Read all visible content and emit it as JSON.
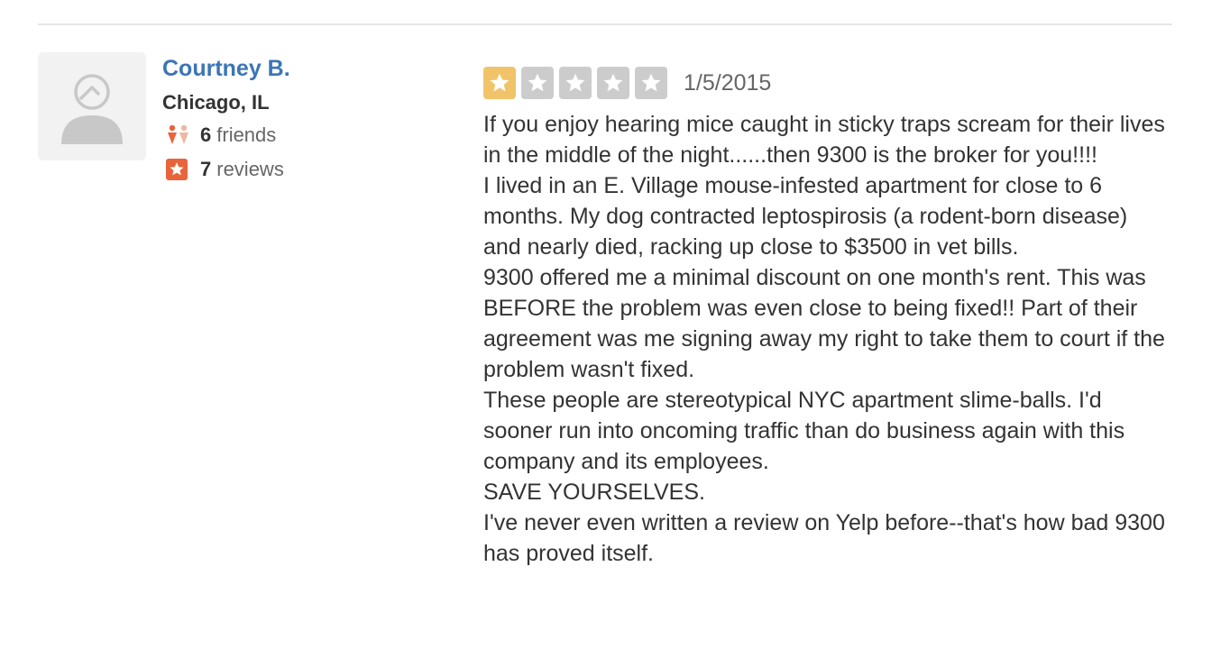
{
  "user": {
    "name": "Courtney B.",
    "location": "Chicago, IL",
    "friends_count": "6",
    "friends_label": "friends",
    "reviews_count": "7",
    "reviews_label": "reviews",
    "avatar_icon": "default-user-avatar-icon",
    "friends_icon": "friends-icon",
    "reviews_icon": "review-star-icon"
  },
  "review": {
    "rating": 1,
    "rating_max": 5,
    "date": "1/5/2015",
    "paragraphs": [
      "If you enjoy hearing mice caught in sticky traps scream for their lives in the middle of the night......then 9300 is the broker for you!!!!",
      "I lived in an E. Village mouse-infested apartment for close to 6 months. My dog contracted leptospirosis (a rodent-born disease) and nearly died, racking up close to $3500 in vet bills.",
      "9300 offered me a minimal discount on one month's rent. This was BEFORE the problem was even close to being fixed!! Part of their agreement was me signing away my right to take them to court if the problem wasn't fixed.",
      "These people are stereotypical NYC apartment slime-balls. I'd sooner run into oncoming traffic than do business again with this company and its employees.",
      "SAVE YOURSELVES.",
      "I've never even written a review on Yelp before--that's how bad 9300 has proved itself."
    ]
  },
  "colors": {
    "link_blue": "#3b75b5",
    "star_filled": "#f2c469",
    "star_empty": "#cccccc",
    "accent_orange": "#e8643a"
  }
}
